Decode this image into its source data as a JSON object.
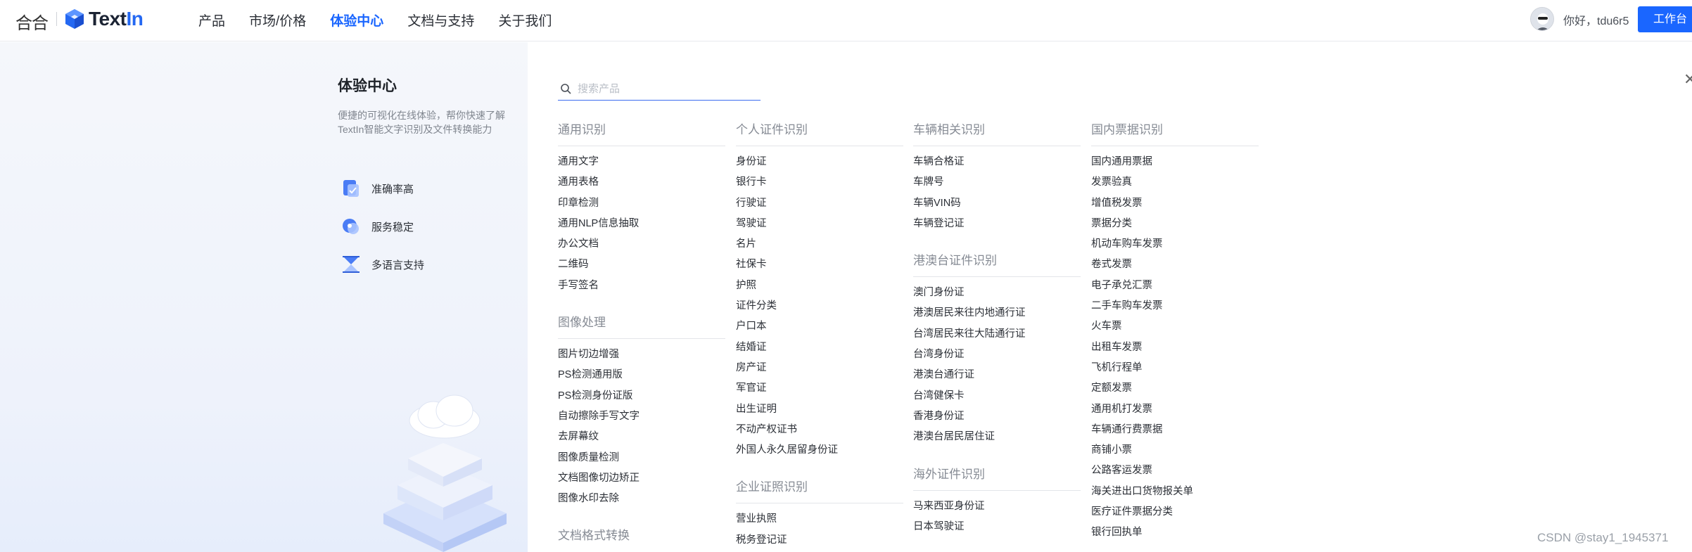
{
  "header": {
    "brand_mark": "合合",
    "logo_text_a": "Text",
    "logo_text_b": "In",
    "nav": [
      "产品",
      "市场/价格",
      "体验中心",
      "文档与支持",
      "关于我们"
    ],
    "greeting": "你好，tdu6r5",
    "workbench_label": "工作台",
    "accent": "#1a66ff"
  },
  "left": {
    "title": "体验中心",
    "description": "便捷的可视化在线体验，帮你快速了解TextIn智能文字识别及文件转换能力",
    "features": [
      {
        "icon": "accuracy-icon",
        "label": "准确率高"
      },
      {
        "icon": "stability-icon",
        "label": "服务稳定"
      },
      {
        "icon": "language-icon",
        "label": "多语言支持"
      }
    ]
  },
  "search": {
    "placeholder": "搜索产品"
  },
  "columns": [
    [
      {
        "title": "通用识别",
        "items": [
          "通用文字",
          "通用表格",
          "印章检测",
          "通用NLP信息抽取",
          "办公文档",
          "二维码",
          "手写签名"
        ]
      },
      {
        "title": "图像处理",
        "items": [
          "图片切边增强",
          "PS检测通用版",
          "PS检测身份证版",
          "自动擦除手写文字",
          "去屏幕纹",
          "图像质量检测",
          "文档图像切边矫正",
          "图像水印去除"
        ]
      },
      {
        "title": "文档格式转换",
        "items": []
      }
    ],
    [
      {
        "title": "个人证件识别",
        "items": [
          "身份证",
          "银行卡",
          "行驶证",
          "驾驶证",
          "名片",
          "社保卡",
          "护照",
          "证件分类",
          "户口本",
          "结婚证",
          "房产证",
          "军官证",
          "出生证明",
          "不动产权证书",
          "外国人永久居留身份证"
        ]
      },
      {
        "title": "企业证照识别",
        "items": [
          "营业执照",
          "税务登记证"
        ]
      }
    ],
    [
      {
        "title": "车辆相关识别",
        "items": [
          "车辆合格证",
          "车牌号",
          "车辆VIN码",
          "车辆登记证"
        ]
      },
      {
        "title": "港澳台证件识别",
        "items": [
          "澳门身份证",
          "港澳居民来往内地通行证",
          "台湾居民来往大陆通行证",
          "台湾身份证",
          "港澳台通行证",
          "台湾健保卡",
          "香港身份证",
          "港澳台居民居住证"
        ]
      },
      {
        "title": "海外证件识别",
        "items": [
          "马来西亚身份证",
          "日本驾驶证"
        ]
      }
    ],
    [
      {
        "title": "国内票据识别",
        "items": [
          "国内通用票据",
          "发票验真",
          "增值税发票",
          "票据分类",
          "机动车购车发票",
          "卷式发票",
          "电子承兑汇票",
          "二手车购车发票",
          "火车票",
          "出租车发票",
          "飞机行程单",
          "定额发票",
          "通用机打发票",
          "车辆通行费票据",
          "商铺小票",
          "公路客运发票",
          "海关进出口货物报关单",
          "医疗证件票据分类",
          "银行回执单"
        ]
      }
    ]
  ],
  "watermark": "CSDN @stay1_1945371"
}
